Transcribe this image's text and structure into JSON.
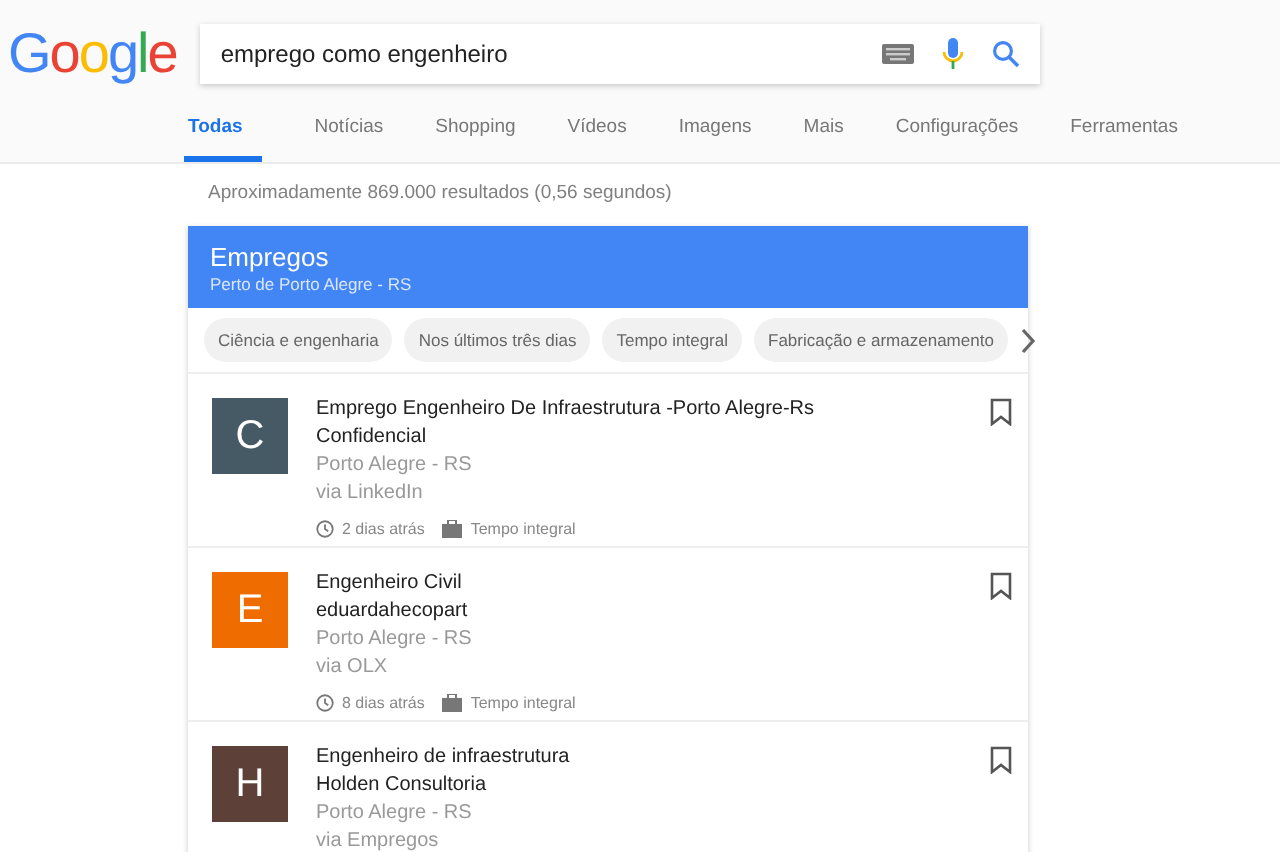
{
  "logo": "Google",
  "search": {
    "value": "emprego como engenheiro"
  },
  "tabs": [
    {
      "label": "Todas",
      "selected": true
    },
    {
      "label": "Notícias",
      "selected": false
    },
    {
      "label": "Shopping",
      "selected": false
    },
    {
      "label": "Vídeos",
      "selected": false
    },
    {
      "label": "Imagens",
      "selected": false
    },
    {
      "label": "Mais",
      "selected": false
    },
    {
      "label": "Configurações",
      "selected": false
    },
    {
      "label": "Ferramentas",
      "selected": false
    }
  ],
  "result_stats": "Aproximadamente 869.000 resultados (0,56 segundos)",
  "jobs_card": {
    "title": "Empregos",
    "subtitle": "Perto de Porto Alegre - RS",
    "chips": [
      "Ciência e engenharia",
      "Nos últimos três dias",
      "Tempo integral",
      "Fabricação e armazenamento"
    ],
    "jobs": [
      {
        "initial": "C",
        "color": "#455a64",
        "title": "Emprego Engenheiro De Infraestrutura -Porto Alegre-Rs",
        "company": "Confidencial",
        "location": "Porto Alegre - RS",
        "source": "via LinkedIn",
        "posted": "2 dias atrás",
        "type": "Tempo integral"
      },
      {
        "initial": "E",
        "color": "#ef6c00",
        "title": "Engenheiro Civil",
        "company": "eduardahecopart",
        "location": "Porto Alegre - RS",
        "source": "via OLX",
        "posted": "8 dias atrás",
        "type": "Tempo integral"
      },
      {
        "initial": "H",
        "color": "#5d4037",
        "title": "Engenheiro de infraestrutura",
        "company": "Holden Consultoria",
        "location": "Porto Alegre - RS",
        "source": "via Empregos"
      }
    ]
  }
}
